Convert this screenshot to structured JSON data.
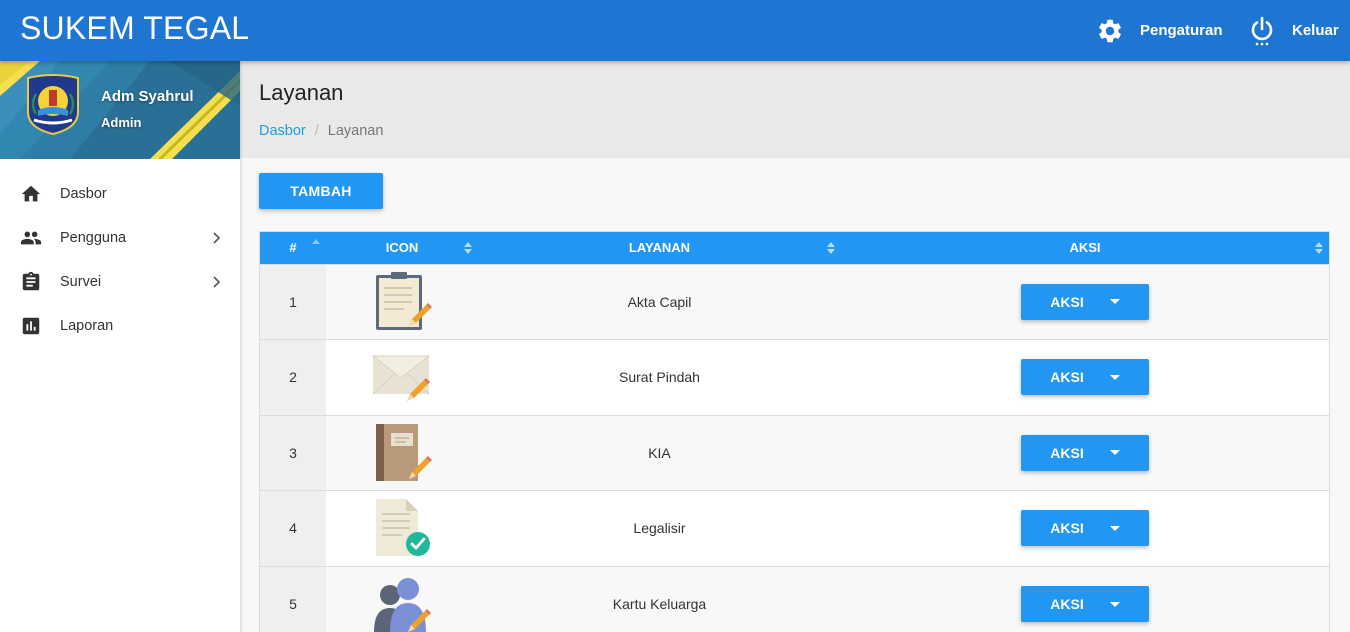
{
  "app": {
    "title": "SUKEM TEGAL"
  },
  "topbar": {
    "settings_label": "Pengaturan",
    "settings_icon": "gear-icon",
    "logout_label": "Keluar",
    "logout_icon": "power-icon"
  },
  "user": {
    "name": "Adm Syahrul",
    "role": "Admin"
  },
  "sidebar": {
    "items": [
      {
        "label": "Dasbor",
        "icon": "home-icon",
        "has_submenu": false
      },
      {
        "label": "Pengguna",
        "icon": "people-icon",
        "has_submenu": true
      },
      {
        "label": "Survei",
        "icon": "clipboard-icon",
        "has_submenu": true
      },
      {
        "label": "Laporan",
        "icon": "bar-chart-icon",
        "has_submenu": false
      }
    ]
  },
  "page": {
    "title": "Layanan",
    "breadcrumb": {
      "home": "Dasbor",
      "separator": "/",
      "current": "Layanan"
    },
    "add_button": "TAMBAH"
  },
  "table": {
    "columns": [
      "#",
      "ICON",
      "LAYANAN",
      "AKSI"
    ],
    "rows": [
      {
        "num": "1",
        "icon": "clipboard-edit-icon",
        "service": "Akta Capil",
        "action": "AKSI"
      },
      {
        "num": "2",
        "icon": "envelope-edit-icon",
        "service": "Surat Pindah",
        "action": "AKSI"
      },
      {
        "num": "3",
        "icon": "book-edit-icon",
        "service": "KIA",
        "action": "AKSI"
      },
      {
        "num": "4",
        "icon": "document-check-icon",
        "service": "Legalisir",
        "action": "AKSI"
      },
      {
        "num": "5",
        "icon": "family-edit-icon",
        "service": "Kartu Keluarga",
        "action": "AKSI"
      }
    ]
  },
  "colors": {
    "primary": "#1f76d2",
    "accent": "#2196f3",
    "link": "#1e9ed6"
  }
}
